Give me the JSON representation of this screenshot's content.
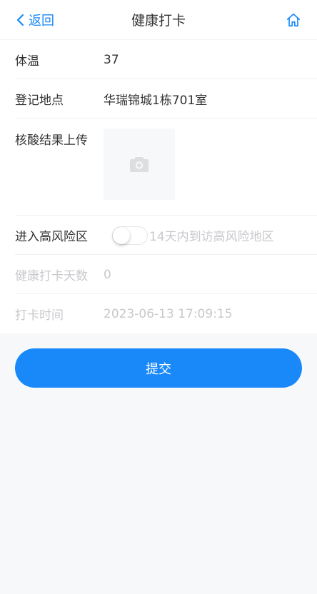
{
  "nav": {
    "back_label": "返回",
    "title": "健康打卡",
    "icons": {
      "back": "chevron-left-icon",
      "home": "home-icon"
    },
    "accent": "#1989fa"
  },
  "form": {
    "temperature": {
      "label": "体温",
      "value": "37"
    },
    "location": {
      "label": "登记地点",
      "value": "华瑞锦城1栋701室"
    },
    "nucleic_upload": {
      "label": "核酸结果上传",
      "icon": "camera-icon"
    },
    "high_risk": {
      "label": "进入高风险区",
      "toggle_on": false,
      "toggle_text": "14天内到访高风险地区"
    },
    "checkin_days": {
      "label": "健康打卡天数",
      "value": "0"
    },
    "checkin_time": {
      "label": "打卡时间",
      "value": "2023-06-13 17:09:15"
    }
  },
  "submit_label": "提交"
}
